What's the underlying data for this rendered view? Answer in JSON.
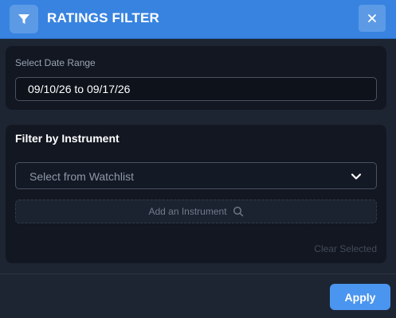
{
  "header": {
    "title": "RATINGS FILTER",
    "icon": "filter-icon",
    "close_icon": "close-icon"
  },
  "date_range": {
    "label": "Select Date Range",
    "value": "09/10/26 to 09/17/26"
  },
  "instrument": {
    "title": "Filter by Instrument",
    "watchlist_placeholder": "Select from Watchlist",
    "dropdown_icon": "chevron-down-icon",
    "add_label": "Add an Instrument",
    "add_icon": "search-icon",
    "clear_label": "Clear Selected"
  },
  "footer": {
    "apply_label": "Apply"
  },
  "colors": {
    "accent": "#3883e0",
    "button": "#4a95ef",
    "background": "#1e2532",
    "card": "#121722"
  }
}
